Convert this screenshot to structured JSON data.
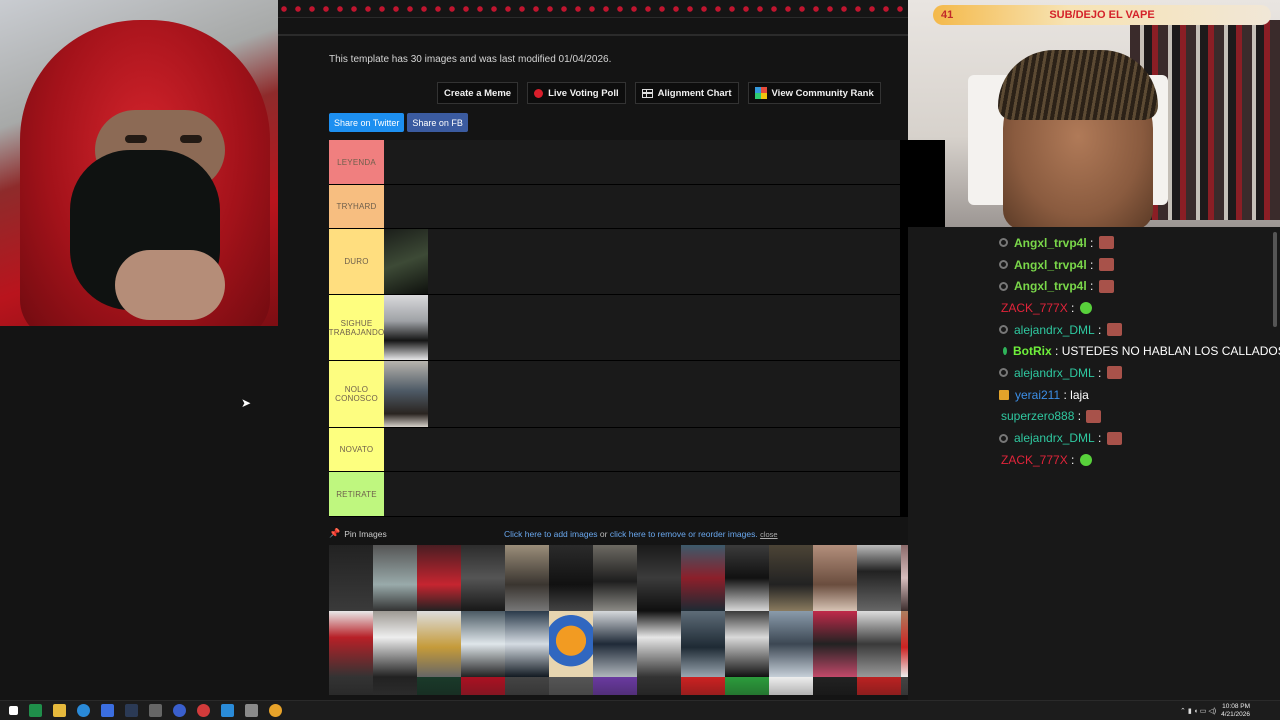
{
  "page": {
    "info_text": "This template has 30 images and was last modified 01/04/2026."
  },
  "buttons": {
    "create_meme": "Create a Meme",
    "live_poll": "Live Voting Poll",
    "alignment_chart": "Alignment Chart",
    "community_rank": "View Community Rank"
  },
  "share": {
    "twitter": "Share on Twitter",
    "facebook": "Share on FB"
  },
  "tiers": [
    {
      "label": "LEYENDA",
      "color": "#f07f7f",
      "images": 0
    },
    {
      "label": "TRYHARD",
      "color": "#f7be80",
      "images": 0
    },
    {
      "label": "DURO",
      "color": "#ffde7f",
      "images": 1
    },
    {
      "label": "SIGHUE TRABAJANDO",
      "color": "#fefe7f",
      "images": 1
    },
    {
      "label": "NOLO CONOSCO",
      "color": "#fdfd80",
      "images": 1
    },
    {
      "label": "NOVATO",
      "color": "#fdff7f",
      "images": 0
    },
    {
      "label": "RETIRATE",
      "color": "#bff77f",
      "images": 0
    }
  ],
  "image_tools": {
    "pin_label": "Pin Images",
    "add_link": "Click here to add images",
    "or_text": " or ",
    "remove_link": "click here to remove or reorder images.",
    "close_link": "close"
  },
  "stream_overlay": {
    "viewer_count": "41",
    "goal_text": "SUB/DEJO EL VAPE"
  },
  "chat": [
    {
      "user": "Angxl_trvp4l",
      "color": "#7ad84a",
      "badge": "circle",
      "text": "",
      "emote": "face"
    },
    {
      "user": "Angxl_trvp4l",
      "color": "#7ad84a",
      "badge": "circle",
      "text": "",
      "emote": "face"
    },
    {
      "user": "Angxl_trvp4l",
      "color": "#7ad84a",
      "badge": "circle",
      "text": "",
      "emote": "face"
    },
    {
      "user": "ZACK_777X",
      "color": "#e1243a",
      "badge": "none",
      "text": "",
      "emote": "green"
    },
    {
      "user": "alejandrx_DML",
      "color": "#2fc8a0",
      "badge": "circle",
      "text": "",
      "emote": "face"
    },
    {
      "user": "BotRix",
      "color": "#6ff03b",
      "badge": "bot",
      "text": "USTEDES NO HABLAN LOS CALLADOS?",
      "emote": "none"
    },
    {
      "user": "alejandrx_DML",
      "color": "#2fc8a0",
      "badge": "circle",
      "text": "",
      "emote": "face"
    },
    {
      "user": "yerai211",
      "color": "#3c8fe8",
      "badge": "crown",
      "text": "laja",
      "emote": "none"
    },
    {
      "user": "superzero888",
      "color": "#2fc8a0",
      "badge": "none",
      "text": "",
      "emote": "face"
    },
    {
      "user": "alejandrx_DML",
      "color": "#2fc8a0",
      "badge": "circle",
      "text": "",
      "emote": "face"
    },
    {
      "user": "ZACK_777X",
      "color": "#e1243a",
      "badge": "none",
      "text": "",
      "emote": "green"
    }
  ],
  "taskbar": {
    "time": "10:08 PM",
    "date": "4/21/2026"
  },
  "colors": {
    "page_bg": "#141414",
    "twitter": "#1d8ff0",
    "facebook": "#3b5ba0",
    "record_red": "#d91e2b"
  }
}
